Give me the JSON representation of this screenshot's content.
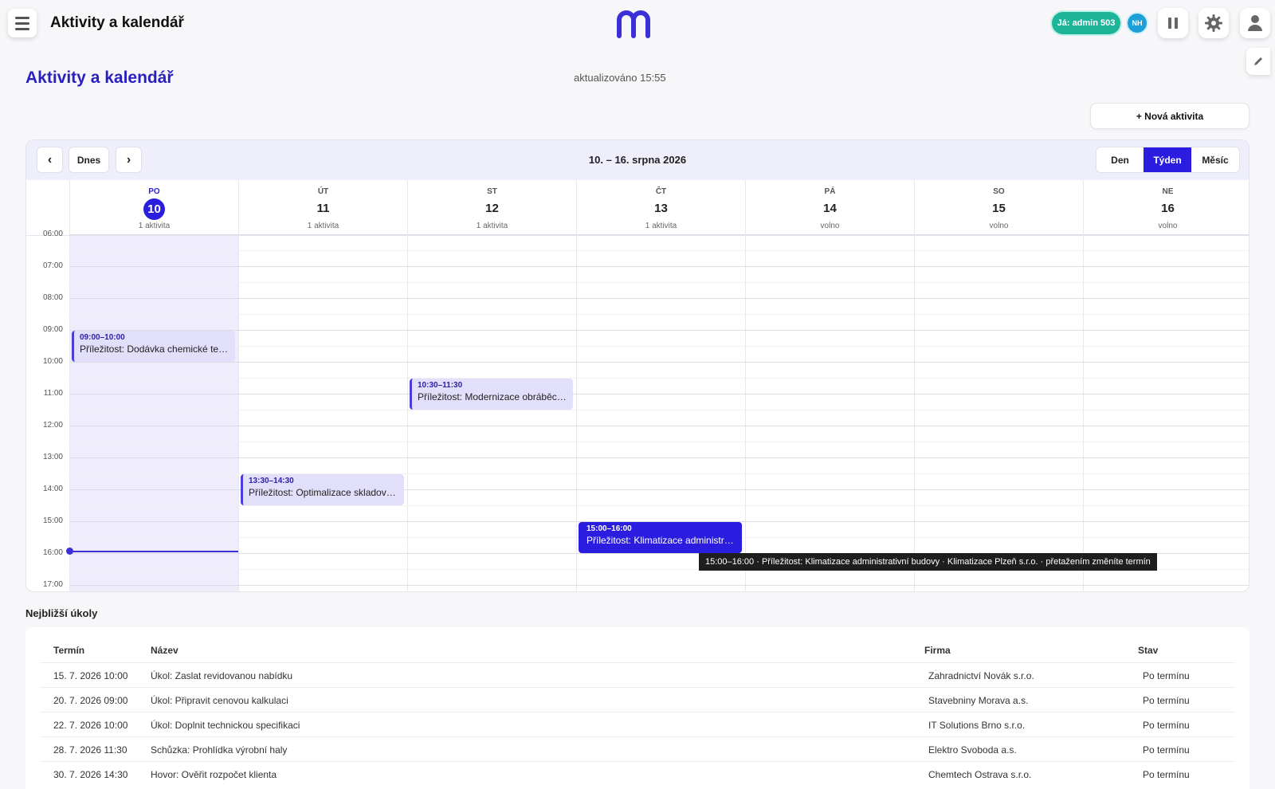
{
  "header": {
    "app_title": "Aktivity a kalendář",
    "me_badge": "Já: admin 503",
    "user_initials": "NH"
  },
  "page": {
    "title": "Aktivity a kalendář",
    "updated": "aktualizováno 15:55",
    "new_activity": "+ Nová aktivita"
  },
  "calendar": {
    "prev": "‹",
    "today": "Dnes",
    "next": "›",
    "range": "10. – 16. srpna 2026",
    "views": {
      "day": "Den",
      "week": "Týden",
      "month": "Měsíc",
      "selected": "Týden"
    },
    "days": [
      {
        "name": "PO",
        "num": "10",
        "sub": "1 aktivita",
        "today": true
      },
      {
        "name": "ÚT",
        "num": "11",
        "sub": "1 aktivita"
      },
      {
        "name": "ST",
        "num": "12",
        "sub": "1 aktivita"
      },
      {
        "name": "ČT",
        "num": "13",
        "sub": "1 aktivita"
      },
      {
        "name": "PÁ",
        "num": "14",
        "sub": "volno"
      },
      {
        "name": "SO",
        "num": "15",
        "sub": "volno"
      },
      {
        "name": "NE",
        "num": "16",
        "sub": "volno"
      }
    ],
    "hours": [
      "06:00",
      "07:00",
      "08:00",
      "09:00",
      "10:00",
      "11:00",
      "12:00",
      "13:00",
      "14:00",
      "15:00",
      "16:00",
      "17:00"
    ],
    "current_time": "15:55",
    "events": [
      {
        "day": 0,
        "start": "09:00",
        "end": "10:00",
        "time": "09:00–10:00",
        "title": "Příležitost: Dodávka chemické tech..."
      },
      {
        "day": 2,
        "start": "10:30",
        "end": "11:30",
        "time": "10:30–11:30",
        "title": "Příležitost: Modernizace obráběcí li..."
      },
      {
        "day": 1,
        "start": "13:30",
        "end": "14:30",
        "time": "13:30–14:30",
        "title": "Příležitost: Optimalizace skladové l..."
      },
      {
        "day": 3,
        "start": "15:00",
        "end": "16:00",
        "time": "15:00–16:00",
        "title": "Příležitost: Klimatizace administrati...",
        "active": true
      }
    ],
    "tooltip": "15:00–16:00 · Příležitost: Klimatizace administrativní budovy · Klimatizace Plzeň s.r.o. · přetažením změníte termín"
  },
  "tasks": {
    "title": "Nejbližší úkoly",
    "columns": {
      "date": "Termín",
      "name": "Název",
      "company": "Firma",
      "status": "Stav"
    },
    "rows": [
      {
        "date": "15. 7. 2026 10:00",
        "name": "Úkol: Zaslat revidovanou nabídku",
        "company": "Zahradnictví Novák s.r.o.",
        "status": "Po termínu"
      },
      {
        "date": "20. 7. 2026 09:00",
        "name": "Úkol: Připravit cenovou kalkulaci",
        "company": "Stavebniny Morava a.s.",
        "status": "Po termínu"
      },
      {
        "date": "22. 7. 2026 10:00",
        "name": "Úkol: Doplnit technickou specifikaci",
        "company": "IT Solutions Brno s.r.o.",
        "status": "Po termínu"
      },
      {
        "date": "28. 7. 2026 11:30",
        "name": "Schůzka: Prohlídka výrobní haly",
        "company": "Elektro Svoboda a.s.",
        "status": "Po termínu"
      },
      {
        "date": "30. 7. 2026 14:30",
        "name": "Hovor: Ověřit rozpočet klienta",
        "company": "Chemtech Ostrava s.r.o.",
        "status": "Po termínu"
      }
    ]
  },
  "colors": {
    "accent": "#2a1de0",
    "title": "#2a1fbf",
    "event_bg": "#e2dffb",
    "me_badge": "#1db59a",
    "nh_badge": "#1f9fd8"
  },
  "icons": {
    "menu": "hamburger-icon",
    "logo": "m-logo",
    "pause": "pause-icon",
    "settings": "gear-icon",
    "user": "user-icon",
    "edit": "pencil-icon"
  }
}
